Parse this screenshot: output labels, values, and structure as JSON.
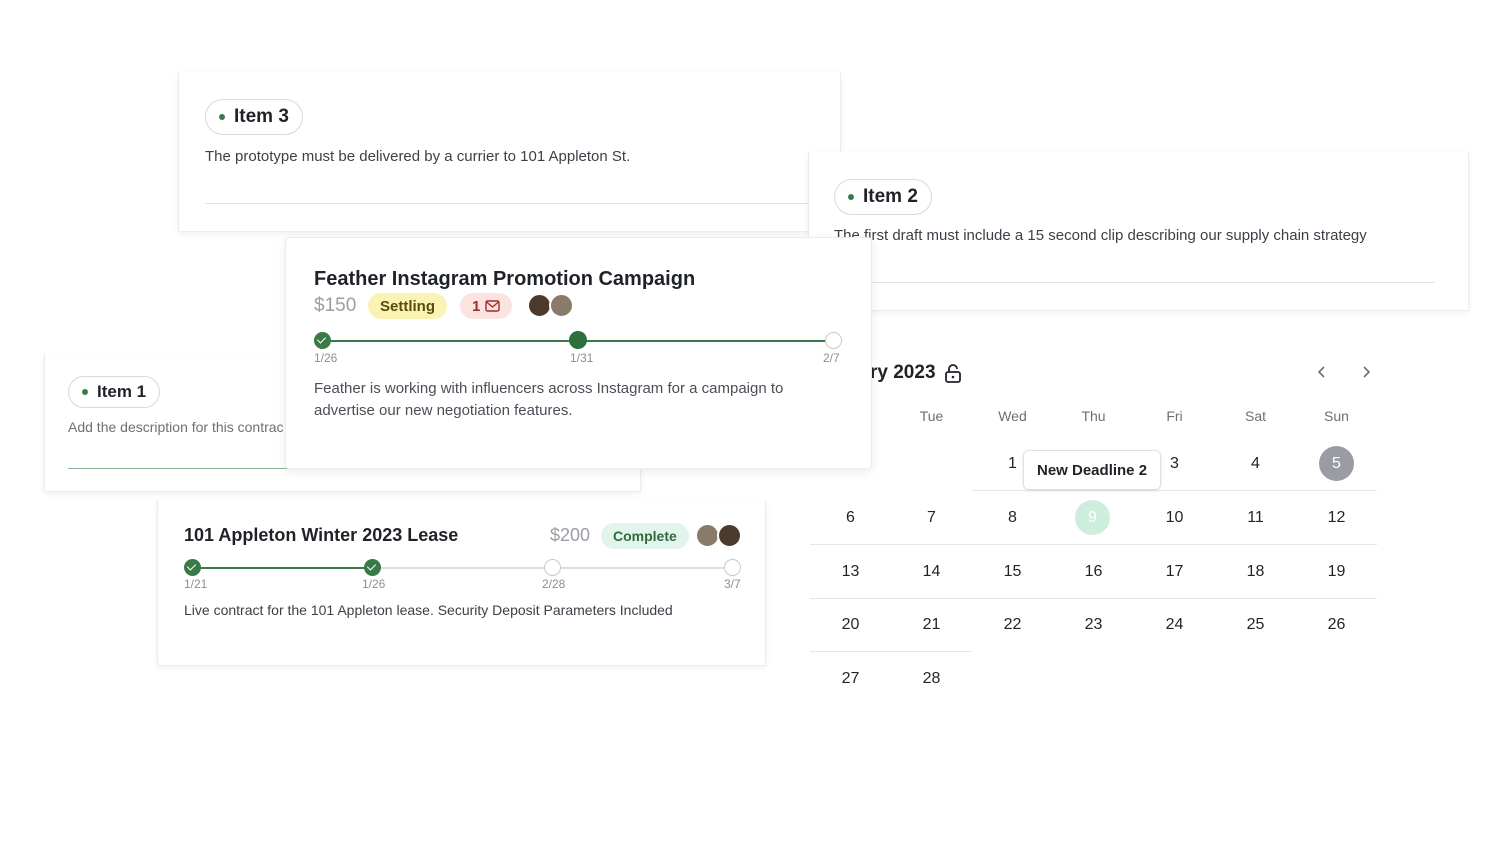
{
  "item3": {
    "label": "Item 3",
    "description": "The prototype must be delivered by a currier to 101 Appleton St."
  },
  "item2": {
    "label": "Item 2",
    "description": "The first draft must include a 15 second clip describing our supply chain strategy"
  },
  "item1": {
    "label": "Item 1",
    "description": "Add the description for this contrac"
  },
  "campaign": {
    "title": "Feather Instagram Promotion Campaign",
    "price": "$150",
    "status": "Settling",
    "message_count": "1",
    "description": "Feather is working with influencers across Instagram for a campaign to advertise our new negotiation features.",
    "milestones": [
      {
        "date": "1/26",
        "state": "done"
      },
      {
        "date": "1/31",
        "state": "current"
      },
      {
        "date": "2/7",
        "state": "todo"
      }
    ]
  },
  "lease": {
    "title": "101 Appleton Winter 2023 Lease",
    "price": "$200",
    "status": "Complete",
    "description": "Live contract for the 101 Appleton lease. Security Deposit Parameters Included",
    "milestones": [
      {
        "date": "1/21",
        "state": "done"
      },
      {
        "date": "1/26",
        "state": "done"
      },
      {
        "date": "2/28",
        "state": "todo"
      },
      {
        "date": "3/7",
        "state": "todo"
      }
    ]
  },
  "calendar": {
    "month_label": "ry 2023",
    "weekdays": [
      "Tue",
      "Wed",
      "Thu",
      "Fri",
      "Sat",
      "Sun"
    ],
    "row1": [
      "1",
      "3",
      "4",
      "5"
    ],
    "row2": [
      "6",
      "7",
      "8",
      "9",
      "10",
      "11",
      "12"
    ],
    "row3": [
      "13",
      "14",
      "15",
      "16",
      "17",
      "18",
      "19"
    ],
    "row4": [
      "20",
      "21",
      "22",
      "23",
      "24",
      "25",
      "26"
    ],
    "row5": [
      "27",
      "28"
    ],
    "tooltip": "New Deadline 2",
    "selected_day": "5",
    "highlighted_day": "9"
  },
  "colors": {
    "accent_green": "#3a7a49",
    "settling_bg": "#fbf3b4",
    "complete_bg": "#e3f4ea",
    "message_bg": "#fbe3e1",
    "selected_day_bg": "#9a9ca3",
    "highlighted_day_bg": "#cdeedd"
  }
}
